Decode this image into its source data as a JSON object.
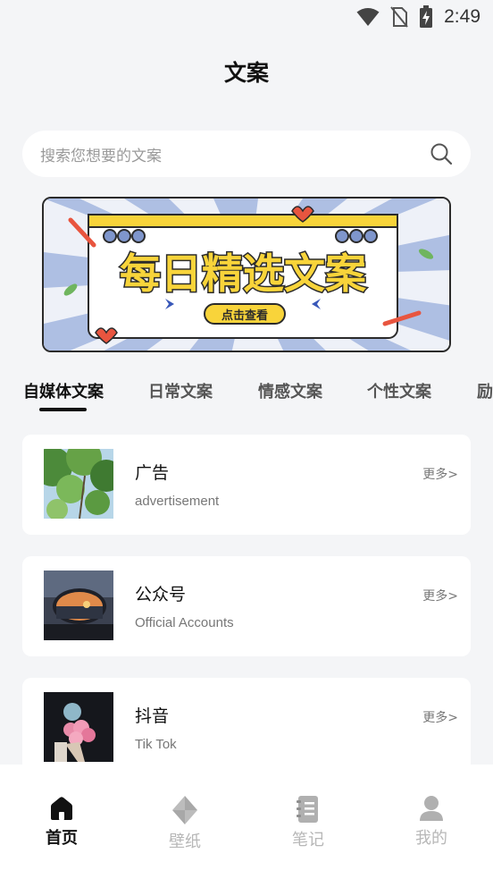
{
  "status_bar": {
    "time": "2:49",
    "icons": [
      "wifi-icon",
      "no-sim-icon",
      "battery-charging-icon"
    ]
  },
  "header": {
    "title": "文案"
  },
  "search": {
    "placeholder": "搜索您想要的文案",
    "icon": "search-icon"
  },
  "banner": {
    "headline": "每日精选文案",
    "button_label": "点击查看"
  },
  "tabs": [
    {
      "label": "自媒体文案",
      "active": true
    },
    {
      "label": "日常文案",
      "active": false
    },
    {
      "label": "情感文案",
      "active": false
    },
    {
      "label": "个性文案",
      "active": false
    },
    {
      "label": "励",
      "active": false
    }
  ],
  "categories": [
    {
      "title": "广告",
      "subtitle": "advertisement",
      "more": "更多>",
      "thumb": "tree-leaves"
    },
    {
      "title": "公众号",
      "subtitle": "Official Accounts",
      "more": "更多>",
      "thumb": "car-mirror-sunset"
    },
    {
      "title": "抖音",
      "subtitle": "Tik Tok",
      "more": "更多>",
      "thumb": "flower-bouquet"
    }
  ],
  "bottom_nav": [
    {
      "label": "首页",
      "icon": "home-icon",
      "active": true
    },
    {
      "label": "壁纸",
      "icon": "wallpaper-icon",
      "active": false
    },
    {
      "label": "笔记",
      "icon": "notebook-icon",
      "active": false
    },
    {
      "label": "我的",
      "icon": "profile-icon",
      "active": false
    }
  ],
  "colors": {
    "background": "#f4f5f7",
    "banner_yellow": "#f8d43a",
    "banner_blue": "#aebfe3",
    "accent": "#111111"
  }
}
